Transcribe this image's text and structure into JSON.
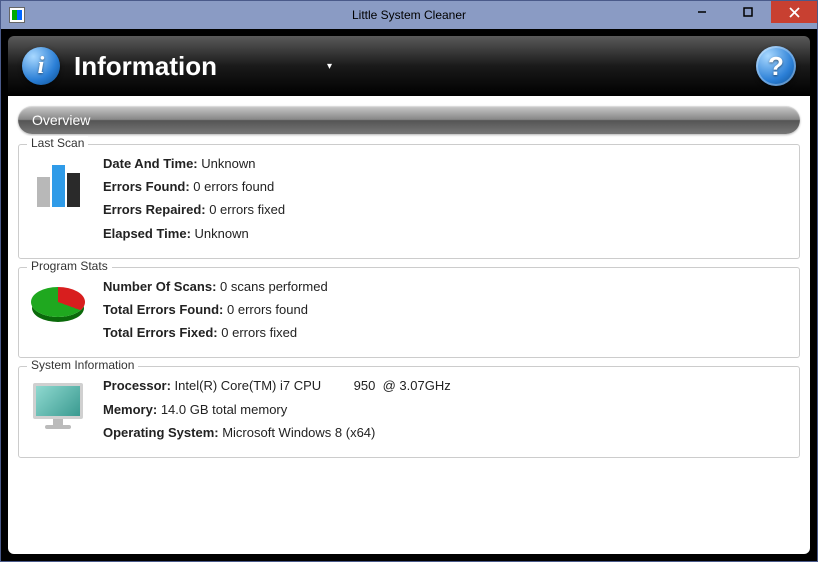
{
  "window": {
    "title": "Little System Cleaner"
  },
  "header": {
    "title": "Information"
  },
  "overview": {
    "label": "Overview"
  },
  "lastScan": {
    "title": "Last Scan",
    "dateTime": {
      "label": "Date And Time:",
      "value": "Unknown"
    },
    "errorsFound": {
      "label": "Errors Found:",
      "value": "0 errors found"
    },
    "errorsRepaired": {
      "label": "Errors Repaired:",
      "value": "0 errors fixed"
    },
    "elapsedTime": {
      "label": "Elapsed Time:",
      "value": "Unknown"
    }
  },
  "programStats": {
    "title": "Program Stats",
    "numScans": {
      "label": "Number Of Scans:",
      "value": "0 scans performed"
    },
    "totalFound": {
      "label": "Total Errors Found:",
      "value": "0 errors found"
    },
    "totalFixed": {
      "label": "Total Errors Fixed:",
      "value": "0 errors fixed"
    }
  },
  "systemInfo": {
    "title": "System Information",
    "processor": {
      "label": "Processor:",
      "value": "Intel(R) Core(TM) i7 CPU         950  @ 3.07GHz"
    },
    "memory": {
      "label": "Memory:",
      "value": "14.0 GB total memory"
    },
    "os": {
      "label": "Operating System:",
      "value": "Microsoft Windows 8  (x64)"
    }
  }
}
